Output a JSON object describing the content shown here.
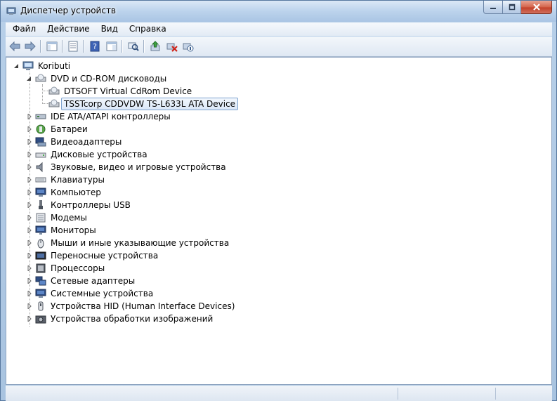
{
  "window": {
    "title": "Диспетчер устройств",
    "icon": "device-manager-icon",
    "controls": [
      "minimize-icon",
      "maximize-icon",
      "close-icon"
    ]
  },
  "menu": {
    "items": [
      "Файл",
      "Действие",
      "Вид",
      "Справка"
    ]
  },
  "toolbar": {
    "buttons": [
      "back-arrow-icon",
      "forward-arrow-icon",
      "show-hide-tree-icon",
      "properties-icon",
      "help-icon",
      "action-pane-icon",
      "scan-hardware-icon",
      "update-driver-icon",
      "uninstall-icon",
      "disable-device-icon"
    ]
  },
  "tree": {
    "root": "Koributi",
    "dvd_group": "DVD и CD-ROM дисководы",
    "dvd_children": [
      "DTSOFT Virtual CdRom Device",
      "TSSTcorp CDDVDW TS-L633L ATA Device"
    ],
    "categories": [
      "IDE ATA/ATAPI контроллеры",
      "Батареи",
      "Видеоадаптеры",
      "Дисковые устройства",
      "Звуковые, видео и игровые устройства",
      "Клавиатуры",
      "Компьютер",
      "Контроллеры USB",
      "Модемы",
      "Мониторы",
      "Мыши и иные указывающие устройства",
      "Переносные устройства",
      "Процессоры",
      "Сетевые адаптеры",
      "Системные устройства",
      "Устройства HID (Human Interface Devices)",
      "Устройства обработки изображений"
    ]
  },
  "colors": {
    "selection_border": "#7da2ce",
    "selection_fill": "#dbe8f8",
    "chrome": "#bcd3ea"
  }
}
